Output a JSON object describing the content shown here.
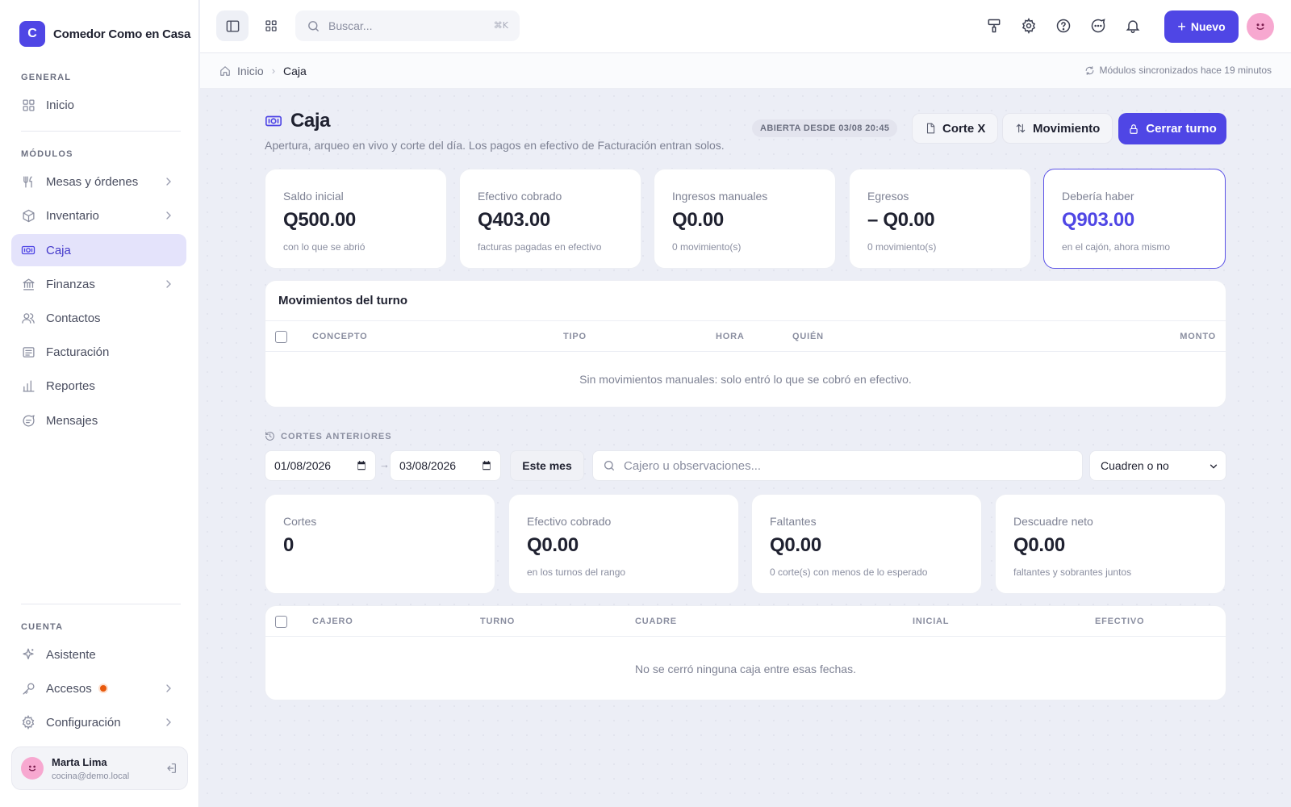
{
  "brand": {
    "logo_letter": "C",
    "name": "Comedor Como en Casa",
    "color": "#4f46e5"
  },
  "sidebar": {
    "general_label": "GENERAL",
    "modules_label": "MÓDULOS",
    "account_label": "CUENTA",
    "items": [
      {
        "label": "Inicio",
        "icon": "grid-icon"
      },
      {
        "label": "Mesas y órdenes",
        "icon": "utensils-icon"
      },
      {
        "label": "Inventario",
        "icon": "box-icon"
      },
      {
        "label": "Caja",
        "icon": "cash-icon"
      },
      {
        "label": "Finanzas",
        "icon": "bank-icon"
      },
      {
        "label": "Contactos",
        "icon": "users-icon"
      },
      {
        "label": "Facturación",
        "icon": "receipt-icon"
      },
      {
        "label": "Reportes",
        "icon": "bar-chart-icon"
      },
      {
        "label": "Mensajes",
        "icon": "message-icon"
      },
      {
        "label": "Asistente",
        "icon": "sparkle-icon"
      },
      {
        "label": "Accesos",
        "icon": "key-icon"
      },
      {
        "label": "Configuración",
        "icon": "gear-icon"
      }
    ],
    "user": {
      "name": "Marta Lima",
      "email": "cocina@demo.local"
    }
  },
  "topbar": {
    "search_placeholder": "Buscar...",
    "search_shortcut": "⌘K",
    "new_label": "Nuevo"
  },
  "breadcrumb": {
    "home": "Inicio",
    "current": "Caja"
  },
  "sync_text": "Módulos sincronizados hace 19 minutos",
  "page": {
    "title": "Caja",
    "subtitle": "Apertura, arqueo en vivo y corte del día. Los pagos en efectivo de Facturación entran solos.",
    "status": "ABIERTA DESDE 03/08 20:45",
    "corte_x": "Corte X",
    "movimiento": "Movimiento",
    "cerrar_turno": "Cerrar turno"
  },
  "stats": [
    {
      "label": "Saldo inicial",
      "value": "Q500.00",
      "note": "con lo que se abrió"
    },
    {
      "label": "Efectivo cobrado",
      "value": "Q403.00",
      "note": "facturas pagadas en efectivo"
    },
    {
      "label": "Ingresos manuales",
      "value": "Q0.00",
      "note": "0 movimiento(s)"
    },
    {
      "label": "Egresos",
      "value": "– Q0.00",
      "note": "0 movimiento(s)"
    },
    {
      "label": "Debería haber",
      "value": "Q903.00",
      "note": "en el cajón, ahora mismo"
    }
  ],
  "movements": {
    "title": "Movimientos del turno",
    "columns": [
      "CONCEPTO",
      "TIPO",
      "HORA",
      "QUIÉN",
      "MONTO"
    ],
    "empty": "Sin movimientos manuales: solo entró lo que se cobró en efectivo."
  },
  "history": {
    "label": "CORTES ANTERIORES",
    "date_from": "01/08/2026",
    "date_to": "03/08/2026",
    "arrow": "→",
    "month_button": "Este mes",
    "search_placeholder": "Cajero u observaciones...",
    "select_value": "Cuadren o no",
    "stats": [
      {
        "label": "Cortes",
        "value": "0",
        "note": ""
      },
      {
        "label": "Efectivo cobrado",
        "value": "Q0.00",
        "note": "en los turnos del rango"
      },
      {
        "label": "Faltantes",
        "value": "Q0.00",
        "note": "0 corte(s) con menos de lo esperado"
      },
      {
        "label": "Descuadre neto",
        "value": "Q0.00",
        "note": "faltantes y sobrantes juntos"
      }
    ],
    "columns": [
      "CAJERO",
      "TURNO",
      "CUADRE",
      "INICIAL",
      "EFECTIVO"
    ],
    "empty": "No se cerró ninguna caja entre esas fechas."
  }
}
